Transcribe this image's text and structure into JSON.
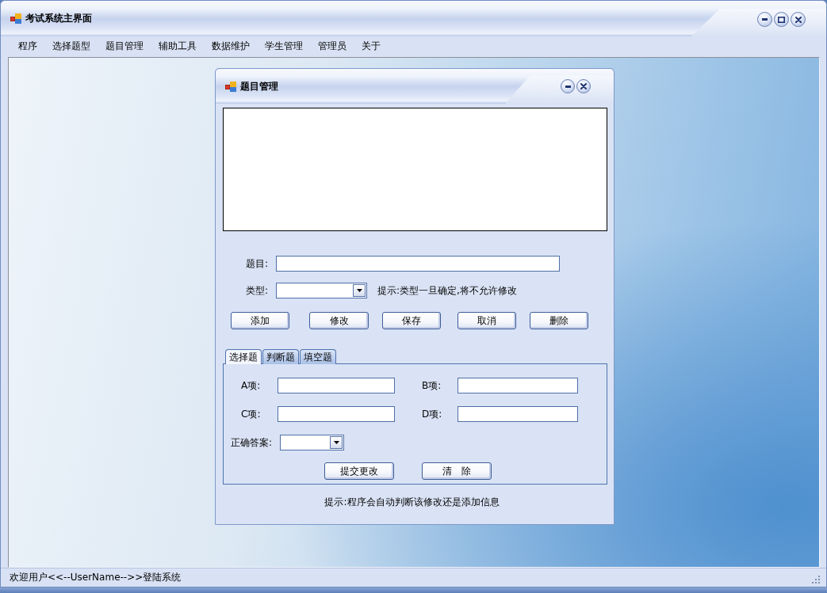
{
  "window": {
    "title": "考试系统主界面",
    "controls": [
      {
        "kind": "minimize"
      },
      {
        "kind": "maximize"
      },
      {
        "kind": "close"
      }
    ]
  },
  "menu": [
    {
      "label": "程序"
    },
    {
      "label": "选择题型"
    },
    {
      "label": "题目管理"
    },
    {
      "label": "辅助工具"
    },
    {
      "label": "数据维护"
    },
    {
      "label": "学生管理"
    },
    {
      "label": "管理员"
    },
    {
      "label": "关于"
    }
  ],
  "child_window": {
    "title": "题目管理",
    "controls": [
      {
        "kind": "minimize"
      },
      {
        "kind": "close"
      }
    ],
    "fields": [
      {
        "label": "题目:",
        "kind": "text"
      },
      {
        "label": "类型:",
        "kind": "dropdown",
        "hint": "提示:类型一旦确定,将不允许修改"
      }
    ],
    "buttons": [
      "添加",
      "修改",
      "保存",
      "取消",
      "删除"
    ],
    "tabs": [
      {
        "label": "选择题",
        "selected": true
      },
      {
        "label": "判断题",
        "selected": false
      },
      {
        "label": "填空题",
        "selected": false
      }
    ],
    "options": [
      {
        "label": "A项:"
      },
      {
        "label": "B项:"
      },
      {
        "label": "C项:"
      },
      {
        "label": "D项:"
      }
    ],
    "answer": {
      "label": "正确答案:"
    },
    "panel_buttons": [
      "提交更改",
      "清   除"
    ],
    "hint": "提示:程序会自动判断该修改还是添加信息"
  },
  "status_bar": {
    "text": "欢迎用户<<--UserName-->>登陆系统"
  }
}
